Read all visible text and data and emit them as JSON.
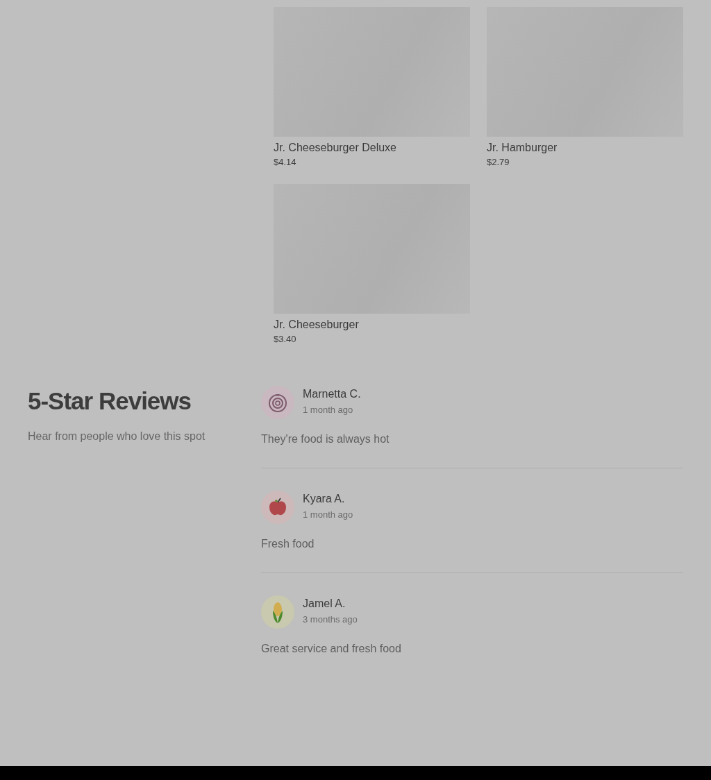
{
  "menu_items": [
    {
      "name": "Jr. Cheeseburger Deluxe",
      "price": "$4.14"
    },
    {
      "name": "Jr. Hamburger",
      "price": "$2.79"
    },
    {
      "name": "Jr. Cheeseburger",
      "price": "$3.40"
    }
  ],
  "reviews_section": {
    "title": "5-Star Reviews",
    "subtitle": "Hear from people who love this spot",
    "reviews": [
      {
        "kind": "onion",
        "name": "Marnetta C.",
        "time": "1 month ago",
        "text": "They're food is always hot"
      },
      {
        "kind": "apple",
        "name": "Kyara A.",
        "time": "1 month ago",
        "text": "Fresh food"
      },
      {
        "kind": "corn",
        "name": "Jamel A.",
        "time": "3 months ago",
        "text": "Great service and fresh food"
      }
    ]
  }
}
